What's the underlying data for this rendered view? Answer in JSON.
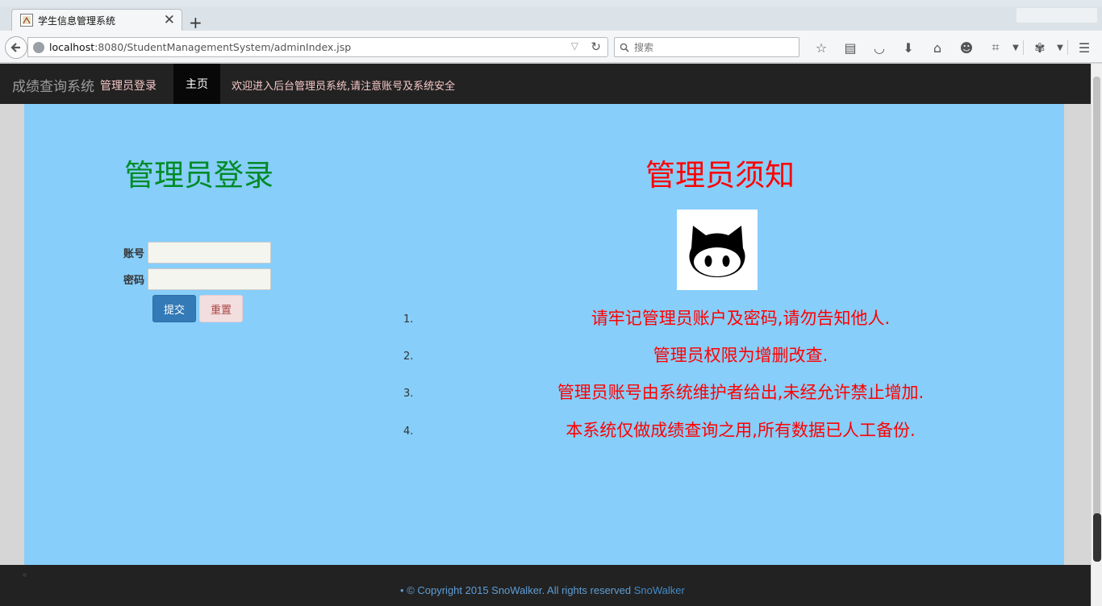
{
  "browser": {
    "tab_title": "学生信息管理系统",
    "tab_close": "✕",
    "new_tab": "+",
    "url_host": "localhost",
    "url_rest": ":8080/StudentManagementSystem/adminIndex.jsp",
    "search_placeholder": "搜索"
  },
  "navbar": {
    "brand": "成绩查询系统",
    "admin_login": "管理员登录",
    "home": "主页",
    "welcome": "欢迎进入后台管理员系统,请注意账号及系统安全"
  },
  "login": {
    "title": "管理员登录",
    "account_label": "账号",
    "password_label": "密码",
    "submit": "提交",
    "reset": "重置"
  },
  "notice": {
    "title": "管理员须知",
    "items": [
      {
        "num": "1.",
        "text": "请牢记管理员账户及密码,请勿告知他人."
      },
      {
        "num": "2.",
        "text": "管理员权限为增删改查."
      },
      {
        "num": "3.",
        "text": "管理员账号由系统维护者给出,未经允许禁止增加."
      },
      {
        "num": "4.",
        "text": "本系统仅做成绩查询之用,所有数据已人工备份."
      }
    ]
  },
  "footer": {
    "bullet": "•",
    "copyright": "© Copyright 2015 SnoWalker. All rights reserved",
    "link": "SnoWalker"
  }
}
